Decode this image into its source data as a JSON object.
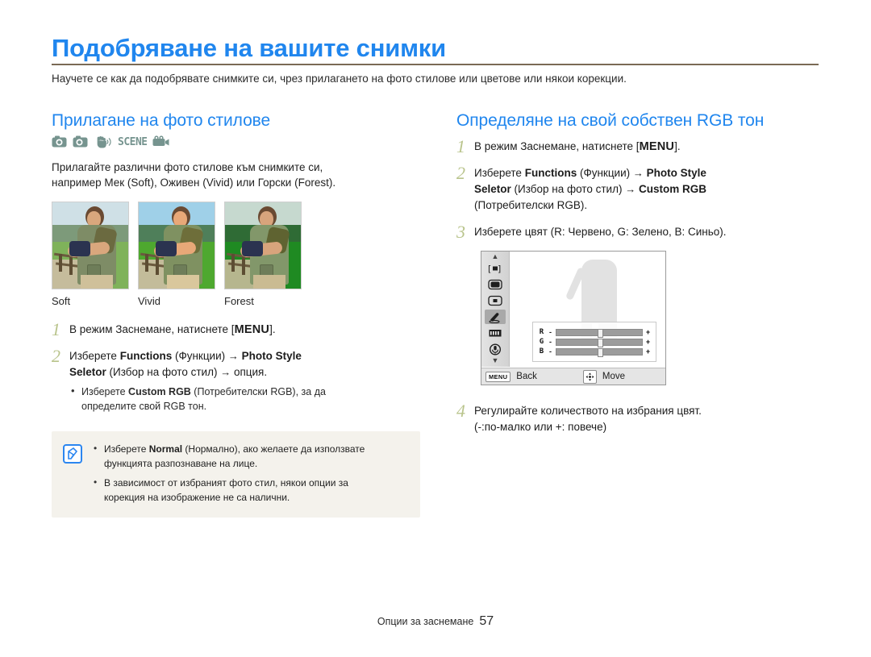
{
  "header": {
    "title": "Подобряване на вашите снимки",
    "lede": "Научете се как да подобрявате снимките си, чрез прилагането на фото стилове или цветове или някои корекции.",
    "rule_color": "#7a6a55",
    "accent_color": "#2086ee"
  },
  "left": {
    "section_title": "Прилагане на фото стилове",
    "mode_icons": [
      {
        "name": "camera-auto-icon",
        "label": "Smart Auto"
      },
      {
        "name": "camera-program-icon",
        "label": "Program"
      },
      {
        "name": "dual-is-icon",
        "label": "Dual IS"
      },
      {
        "name": "scene-icon",
        "label": "SCENE"
      },
      {
        "name": "movie-icon",
        "label": "Movie"
      }
    ],
    "intro_line1": "Прилагайте различни фото стилове към снимките си,",
    "intro_line2": "например Мек (Soft), Оживен (Vivid) или Горски (Forest).",
    "thumbnails": [
      {
        "label": "Soft",
        "sky": "#cfe0e6",
        "hills": "#7d9a7a",
        "grass": "#7fb25a"
      },
      {
        "label": "Vivid",
        "sky": "#9fd0e8",
        "hills": "#4f7f5a",
        "grass": "#4ea82f"
      },
      {
        "label": "Forest",
        "sky": "#c6d9cf",
        "hills": "#2f6b35",
        "grass": "#1f8a22"
      }
    ],
    "steps": [
      {
        "num": "1",
        "parts": [
          {
            "t": "В режим Заснемане, натиснете [",
            "b": false
          },
          {
            "t": "MENU",
            "b": true,
            "kbd": true
          },
          {
            "t": "].",
            "b": false
          }
        ],
        "plain": "В режим Заснемане, натиснете [MENU]."
      },
      {
        "num": "2",
        "plain": "Изберете Functions (Функции) → Photo Style Seletor (Избор на фото стил) → опция.",
        "bullets": [
          "Изберете Custom RGB (Потребителски RGB), за да определите свой RGB тон."
        ]
      }
    ],
    "step2_line1_a": "Изберете ",
    "step2_line1_b": "Functions",
    "step2_line1_c": " (Функции) ",
    "step2_arrow": "→",
    "step2_line1_d": "Photo Style",
    "step2_line2_a": "Seletor",
    "step2_line2_b": " (Избор на фото стил) ",
    "step2_line2_c": "опция.",
    "step2_bullet_a": "Изберете ",
    "step2_bullet_b": "Custom RGB",
    "step2_bullet_c": " (Потребителски RGB), за да",
    "step2_bullet_d": "определите свой RGB тон.",
    "tip_icon": "note-pen-icon",
    "tips": [
      {
        "a": "Изберете ",
        "b": "Normal",
        "c": " (Нормално), ако желаете да използвате",
        "d": "функцията разпознаване на лице."
      },
      {
        "a": "",
        "b": "",
        "c": "В зависимост от избраният фото стил, някои опции за",
        "d": "корекция на изображение не са налични."
      }
    ]
  },
  "right": {
    "section_title": "Определяне на свой собствен RGB тон",
    "step1_num": "1",
    "step1_a": "В режим Заснемане, натиснете [",
    "step1_kbd": "MENU",
    "step1_b": "].",
    "step2_num": "2",
    "step2_l1_a": "Изберете ",
    "step2_l1_b": "Functions",
    "step2_l1_c": " (Функции) ",
    "step2_arrow": "→",
    "step2_l1_d": "Photo Style",
    "step2_l2_a": "Seletor",
    "step2_l2_b": " (Избор на фото стил) ",
    "step2_l2_c": "Custom RGB",
    "step2_l3": "(Потребителски RGB).",
    "step3_num": "3",
    "step3_text": "Изберете цвят (R: Червено, G: Зелено, B: Синьо).",
    "step4_num": "4",
    "step4_l1": "Регулирайте количеството на избрания цвят.",
    "step4_l2": "(-:по-малко или +: повече)",
    "lcd": {
      "caret_up": "▲",
      "caret_down": "▼",
      "side_icons": [
        {
          "name": "focus-area-icon",
          "glyph": "[▪]",
          "selected": false
        },
        {
          "name": "frame-icon",
          "glyph": "▬",
          "selected": false
        },
        {
          "name": "center-frame-icon",
          "glyph": "■",
          "selected": false
        },
        {
          "name": "photo-style-icon",
          "glyph": "✒",
          "selected": true
        },
        {
          "name": "image-adjust-icon",
          "glyph": "█",
          "selected": false
        },
        {
          "name": "voice-icon",
          "glyph": "◉",
          "selected": false
        }
      ],
      "sliders": [
        {
          "label": "R",
          "minus": "-",
          "plus": "+",
          "value": 50
        },
        {
          "label": "G",
          "minus": "-",
          "plus": "+",
          "value": 50
        },
        {
          "label": "B",
          "minus": "-",
          "plus": "+",
          "value": 50
        }
      ],
      "menu_chip": "MENU",
      "back_label": "Back",
      "dpad_icon": "dpad-icon",
      "move_label": "Move"
    }
  },
  "footer": {
    "text": "Опции за заснемане",
    "page": "57"
  }
}
